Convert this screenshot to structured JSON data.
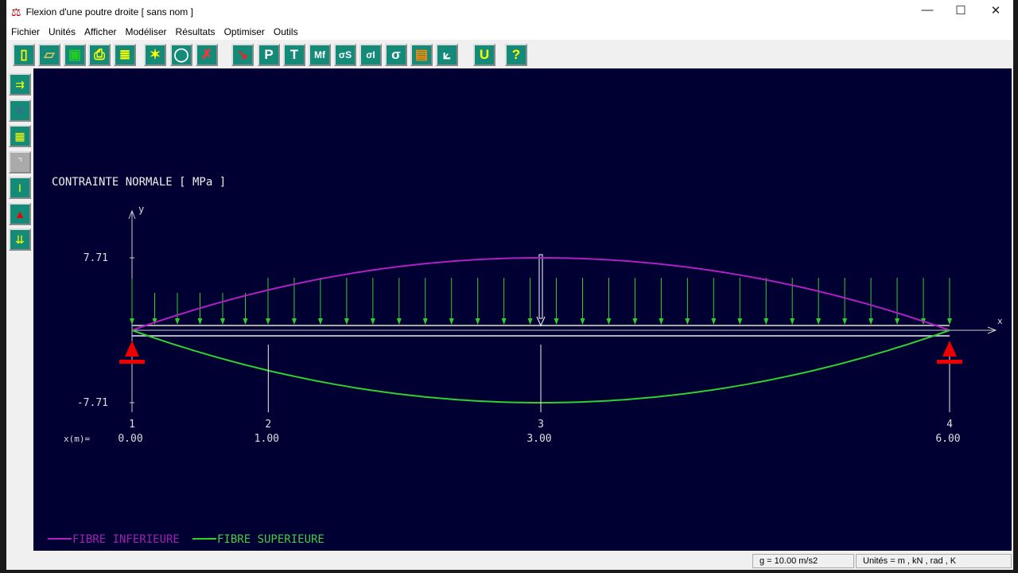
{
  "window": {
    "title": "Flexion d'une poutre droite    [ sans nom ]",
    "minimize": "—",
    "maximize": "☐",
    "close": "✕"
  },
  "menu": [
    "Fichier",
    "Unités",
    "Afficher",
    "Modéliser",
    "Résultats",
    "Optimiser",
    "Outils"
  ],
  "toolbar": [
    {
      "icon": "new-file-icon",
      "glyph": "▯"
    },
    {
      "icon": "open-folder-icon",
      "glyph": "▱"
    },
    {
      "icon": "save-icon",
      "glyph": "▣"
    },
    {
      "icon": "print-icon",
      "glyph": "⎙"
    },
    {
      "icon": "notes-icon",
      "glyph": "≣"
    },
    {
      "icon": "sun-icon",
      "glyph": "✶"
    },
    {
      "icon": "zoom-icon",
      "glyph": "◯"
    },
    {
      "icon": "zoom-cancel-icon",
      "glyph": "✗"
    },
    {
      "icon": "beam-load-icon",
      "glyph": "↘"
    },
    {
      "icon": "P",
      "glyph": "P"
    },
    {
      "icon": "T",
      "glyph": "T"
    },
    {
      "icon": "Mf",
      "glyph": "Mf"
    },
    {
      "icon": "sigma-s",
      "glyph": "σS"
    },
    {
      "icon": "sigma-i",
      "glyph": "σI"
    },
    {
      "icon": "sigma",
      "glyph": "σ"
    },
    {
      "icon": "color-scale-icon",
      "glyph": "▤"
    },
    {
      "icon": "axes-icon",
      "glyph": "⟀"
    },
    {
      "icon": "U",
      "glyph": "U"
    },
    {
      "icon": "help-icon",
      "glyph": "?"
    }
  ],
  "sidebar": [
    {
      "icon": "beam-nodes-icon",
      "glyph": "⇉"
    },
    {
      "icon": "material-grid-icon",
      "glyph": "⁙"
    },
    {
      "icon": "section-box-icon",
      "glyph": "▦"
    },
    {
      "icon": "angle-icon",
      "glyph": "⌝"
    },
    {
      "icon": "i-section-icon",
      "glyph": "I"
    },
    {
      "icon": "support-icon",
      "glyph": "▲"
    },
    {
      "icon": "distributed-load-icon",
      "glyph": "⇊"
    }
  ],
  "chart_data": {
    "type": "line",
    "title": "CONTRAINTE NORMALE [  MPa  ]",
    "xlabel": "x",
    "ylabel": "y",
    "ytick_labels": [
      "7.71",
      "-7.71"
    ],
    "ylim": [
      -7.71,
      7.71
    ],
    "xprefix": "x(m)=",
    "nodes": [
      {
        "id": "1",
        "x": "0.00"
      },
      {
        "id": "2",
        "x": "1.00"
      },
      {
        "id": "3",
        "x": "3.00"
      },
      {
        "id": "4",
        "x": "6.00"
      }
    ],
    "x": [
      0,
      1,
      2,
      3,
      4,
      5,
      6
    ],
    "series": [
      {
        "name": "FIBRE INFERIEURE",
        "color": "#b020c0",
        "values": [
          0,
          4.28,
          6.85,
          7.71,
          6.85,
          4.28,
          0
        ]
      },
      {
        "name": "FIBRE SUPERIEURE",
        "color": "#30d030",
        "values": [
          0,
          -4.28,
          -6.85,
          -7.71,
          -6.85,
          -4.28,
          0
        ]
      }
    ],
    "legend": "bottom-left"
  },
  "status": {
    "gravity": "g = 10.00 m/s2",
    "units": "Unités = m , kN , rad , K"
  }
}
